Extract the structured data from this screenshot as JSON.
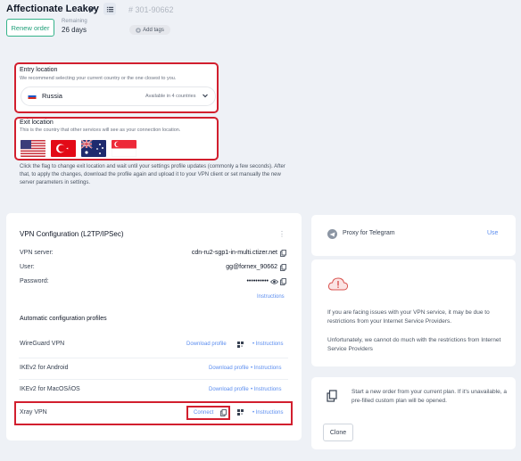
{
  "header": {
    "title": "Affectionate Leakey",
    "order_id": "# 301-90662",
    "renew_label": "Renew order",
    "remaining_label": "Remaining",
    "remaining_value": "26 days",
    "add_tags_label": "Add tags"
  },
  "entry": {
    "title": "Entry location",
    "subtitle": "We recommend selecting your current country or the one closest to you.",
    "country": "Russia",
    "availability": "Available in 4 countries"
  },
  "exit": {
    "title": "Exit location",
    "subtitle": "This is the country that other services will see as your connection location.",
    "flags": [
      "us-flag",
      "tr-flag",
      "au-flag",
      "sg-flag"
    ],
    "help": "Click the flag to change exit location and wait until your settings profile updates (commonly a few seconds). After that, to apply the changes, download the profile again and upload it to your VPN client or set manually the new server parameters in settings."
  },
  "vpn": {
    "title": "VPN Configuration (L2TP/IPSec)",
    "server_label": "VPN server:",
    "server_value": "cdn-ru2-sgp1-in-multi.ctizer.net",
    "user_label": "User:",
    "user_value": "gg@fornex_90662",
    "password_label": "Password:",
    "password_value": "••••••••••",
    "instructions": "Instructions",
    "profiles_label": "Automatic configuration profiles",
    "profiles": [
      {
        "name": "WireGuard VPN",
        "action": "Download profile",
        "instr": "• Instructions"
      },
      {
        "name": "IKEv2 for Android",
        "action": "Download profile",
        "instr": "• Instructions"
      },
      {
        "name": "IKEv2 for MacOS/iOS",
        "action": "Download profile",
        "instr": "• Instructions"
      },
      {
        "name": "Xray VPN",
        "action": "Connect",
        "instr": "• Instructions"
      }
    ]
  },
  "right": {
    "telegram_label": "Proxy for Telegram",
    "telegram_action": "Use",
    "warning_1": "If you are facing issues with your VPN service, it may be due to restrictions from your Internet Service Providers.",
    "warning_2": "Unfortunately, we cannot do much with the restrictions from Internet Service Providers",
    "new_order_text": "Start a new order from your current plan. If it's unavailable, a pre-filled custom plan will be opened.",
    "clone_label": "Clone"
  },
  "colors": {
    "accent": "#5b8def",
    "highlight": "#d21f2e",
    "renew": "#22a07a"
  }
}
